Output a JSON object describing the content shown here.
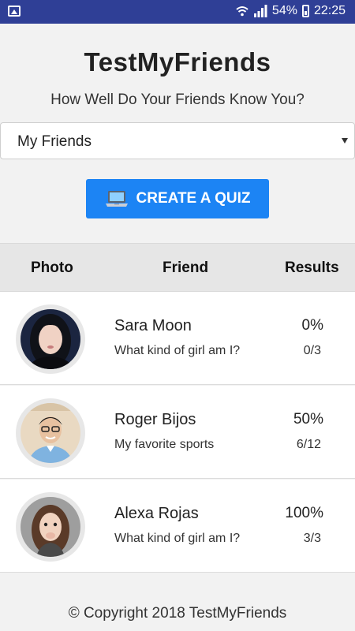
{
  "statusbar": {
    "battery": "54%",
    "time": "22:25"
  },
  "header": {
    "title": "TestMyFriends",
    "subtitle": "How Well Do Your Friends Know You?"
  },
  "select": {
    "value": "My Friends"
  },
  "create_button": {
    "label": "CREATE A QUIZ"
  },
  "table": {
    "headers": [
      "Photo",
      "Friend",
      "Results"
    ],
    "rows": [
      {
        "name": "Sara Moon",
        "quiz": "What kind of girl am I?",
        "percent": "0%",
        "score": "0/3"
      },
      {
        "name": "Roger Bijos",
        "quiz": "My favorite sports",
        "percent": "50%",
        "score": "6/12"
      },
      {
        "name": "Alexa Rojas",
        "quiz": "What kind of girl am I?",
        "percent": "100%",
        "score": "3/3"
      }
    ]
  },
  "footer": {
    "text": "© Copyright 2018 TestMyFriends"
  },
  "colors": {
    "statusbar": "#2f3f96",
    "button": "#1c84f4",
    "background": "#f2f2f2"
  }
}
